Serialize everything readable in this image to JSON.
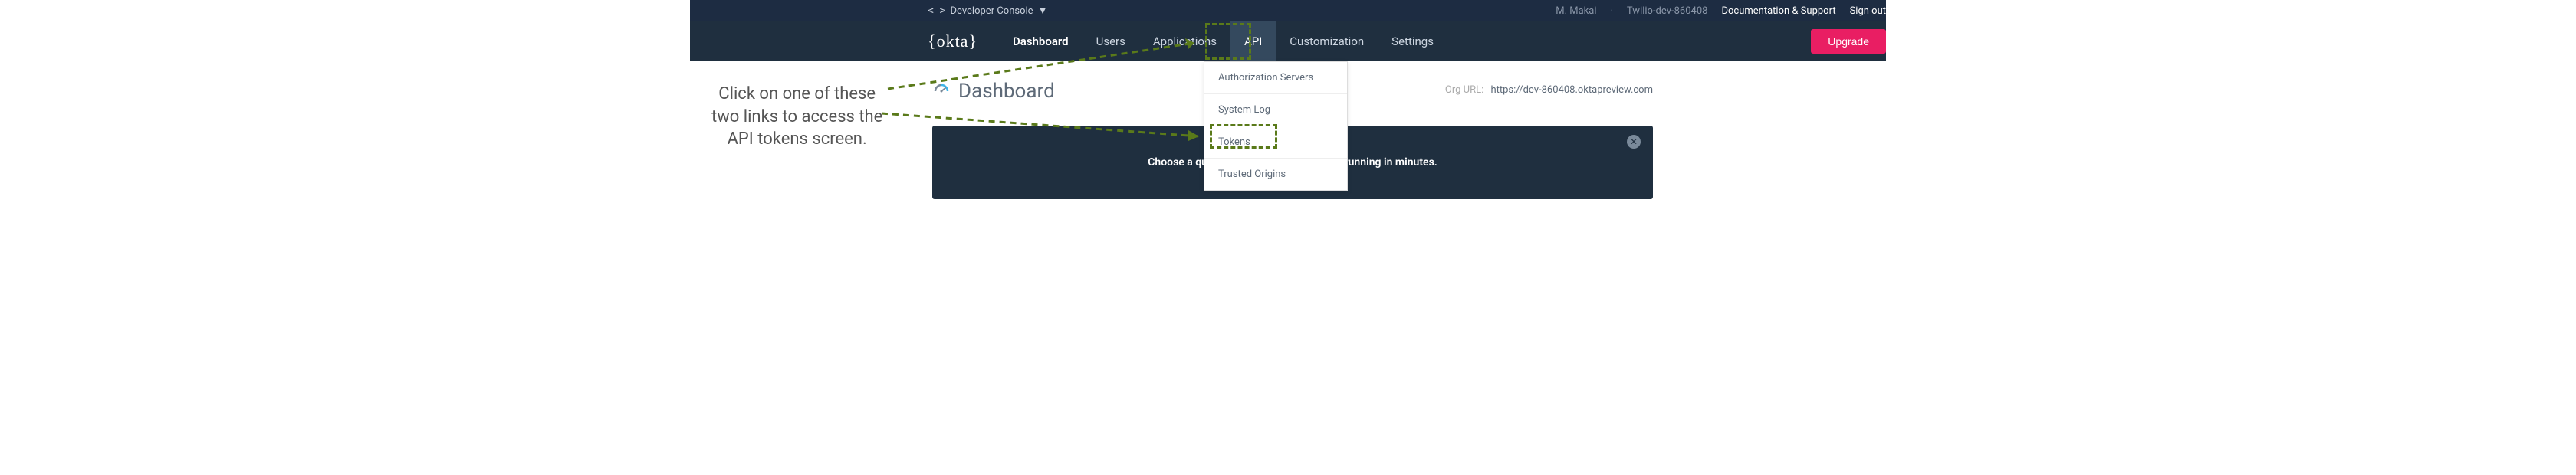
{
  "topBar": {
    "console": "Developer Console",
    "user": "M. Makai",
    "org": "Twilio-dev-860408",
    "docs": "Documentation & Support",
    "signOut": "Sign out"
  },
  "nav": {
    "logo": "okta",
    "items": [
      "Dashboard",
      "Users",
      "Applications",
      "API",
      "Customization",
      "Settings"
    ],
    "activeIndex": 3,
    "upgrade": "Upgrade"
  },
  "dropdown": {
    "items": [
      "Authorization Servers",
      "System Log",
      "Tokens",
      "Trusted Origins"
    ]
  },
  "page": {
    "title": "Dashboard",
    "orgUrlLabel": "Org URL:",
    "orgUrl": "https://dev-860408.oktapreview.com",
    "quickstart": "Choose a quick start guide to get up and running in minutes."
  },
  "annotation": {
    "line1": "Click on one of these",
    "line2": "two links to access the",
    "line3": "API tokens screen."
  },
  "colors": {
    "accent": "#e91e63",
    "highlight": "#5a7a1a"
  }
}
